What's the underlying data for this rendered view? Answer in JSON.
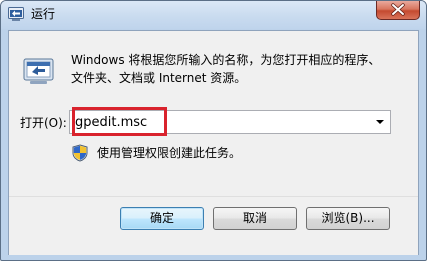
{
  "window": {
    "title": "运行",
    "close_icon": "close-icon",
    "title_icon": "run-app-icon"
  },
  "main": {
    "icon": "run-program-icon",
    "description_line1": "Windows 将根据您所输入的名称，为您打开相应的程序、",
    "description_line2": "文件夹、文档或 Internet 资源。",
    "open_label": "打开(O):",
    "open_value": "gpedit.msc",
    "admin_icon": "uac-shield-icon",
    "admin_note": "使用管理权限创建此任务。"
  },
  "buttons": {
    "ok": "确定",
    "cancel": "取消",
    "browse": "浏览(B)..."
  },
  "colors": {
    "highlight": "#d9232d",
    "title_bar": "#c9dbef",
    "close_button": "#c44a30",
    "client_bg": "#f0f0f0"
  }
}
